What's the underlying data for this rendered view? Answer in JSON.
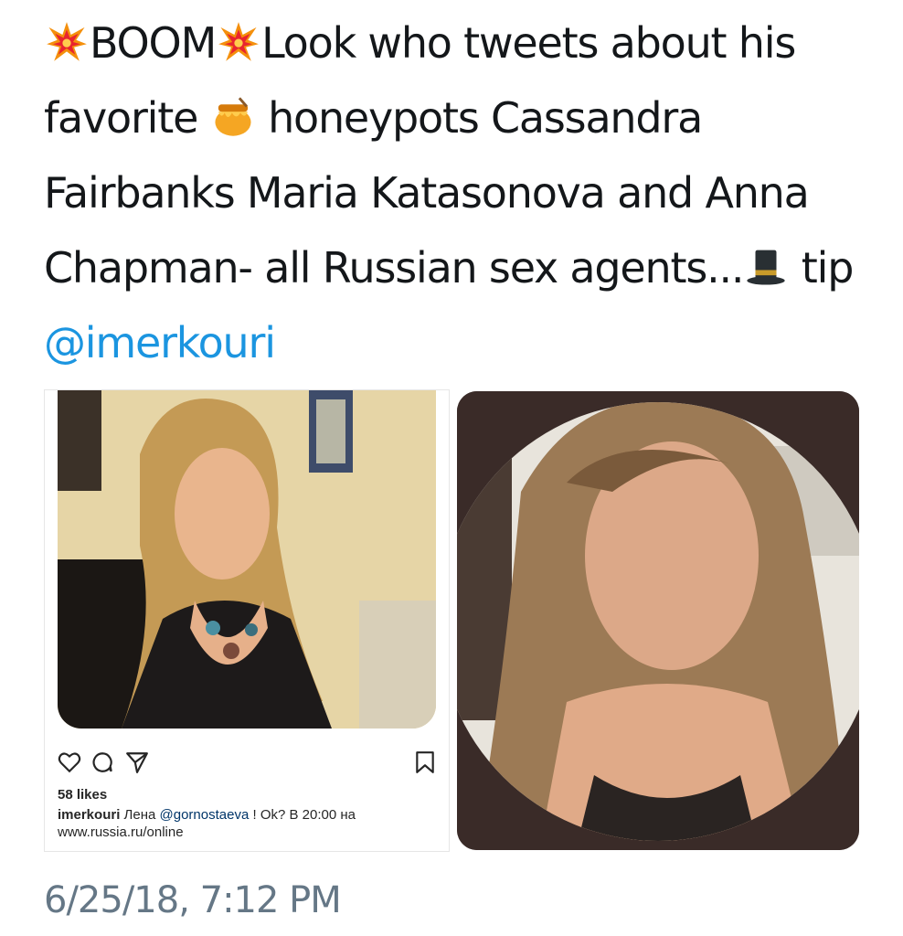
{
  "tweet": {
    "text_part1": "BOOM",
    "text_part2": "Look who tweets about his favorite",
    "text_part3": "honeypots Cassandra Fairbanks  Maria Katasonova and Anna Chapman- all Russian sex agents...",
    "text_part4": "tip",
    "mention": "@imerkouri",
    "emoji_icons": [
      "collision-icon",
      "collision-icon",
      "honey-pot-icon",
      "top-hat-icon"
    ],
    "timestamp": "6/25/18, 7:12 PM"
  },
  "instagram_post": {
    "likes": "58 likes",
    "caption_user": "imerkouri",
    "caption_text1": "Лена",
    "caption_tag": "@gornostaeva",
    "caption_text2": "! Ok? В 20:00 на",
    "caption_url": "www.russia.ru/online",
    "action_icons": [
      "heart-icon",
      "comment-icon",
      "share-icon",
      "bookmark-icon"
    ]
  },
  "colors": {
    "text": "#14171a",
    "mention": "#1b95e0",
    "timestamp": "#657786",
    "portrait_background": "#3a2b28"
  }
}
